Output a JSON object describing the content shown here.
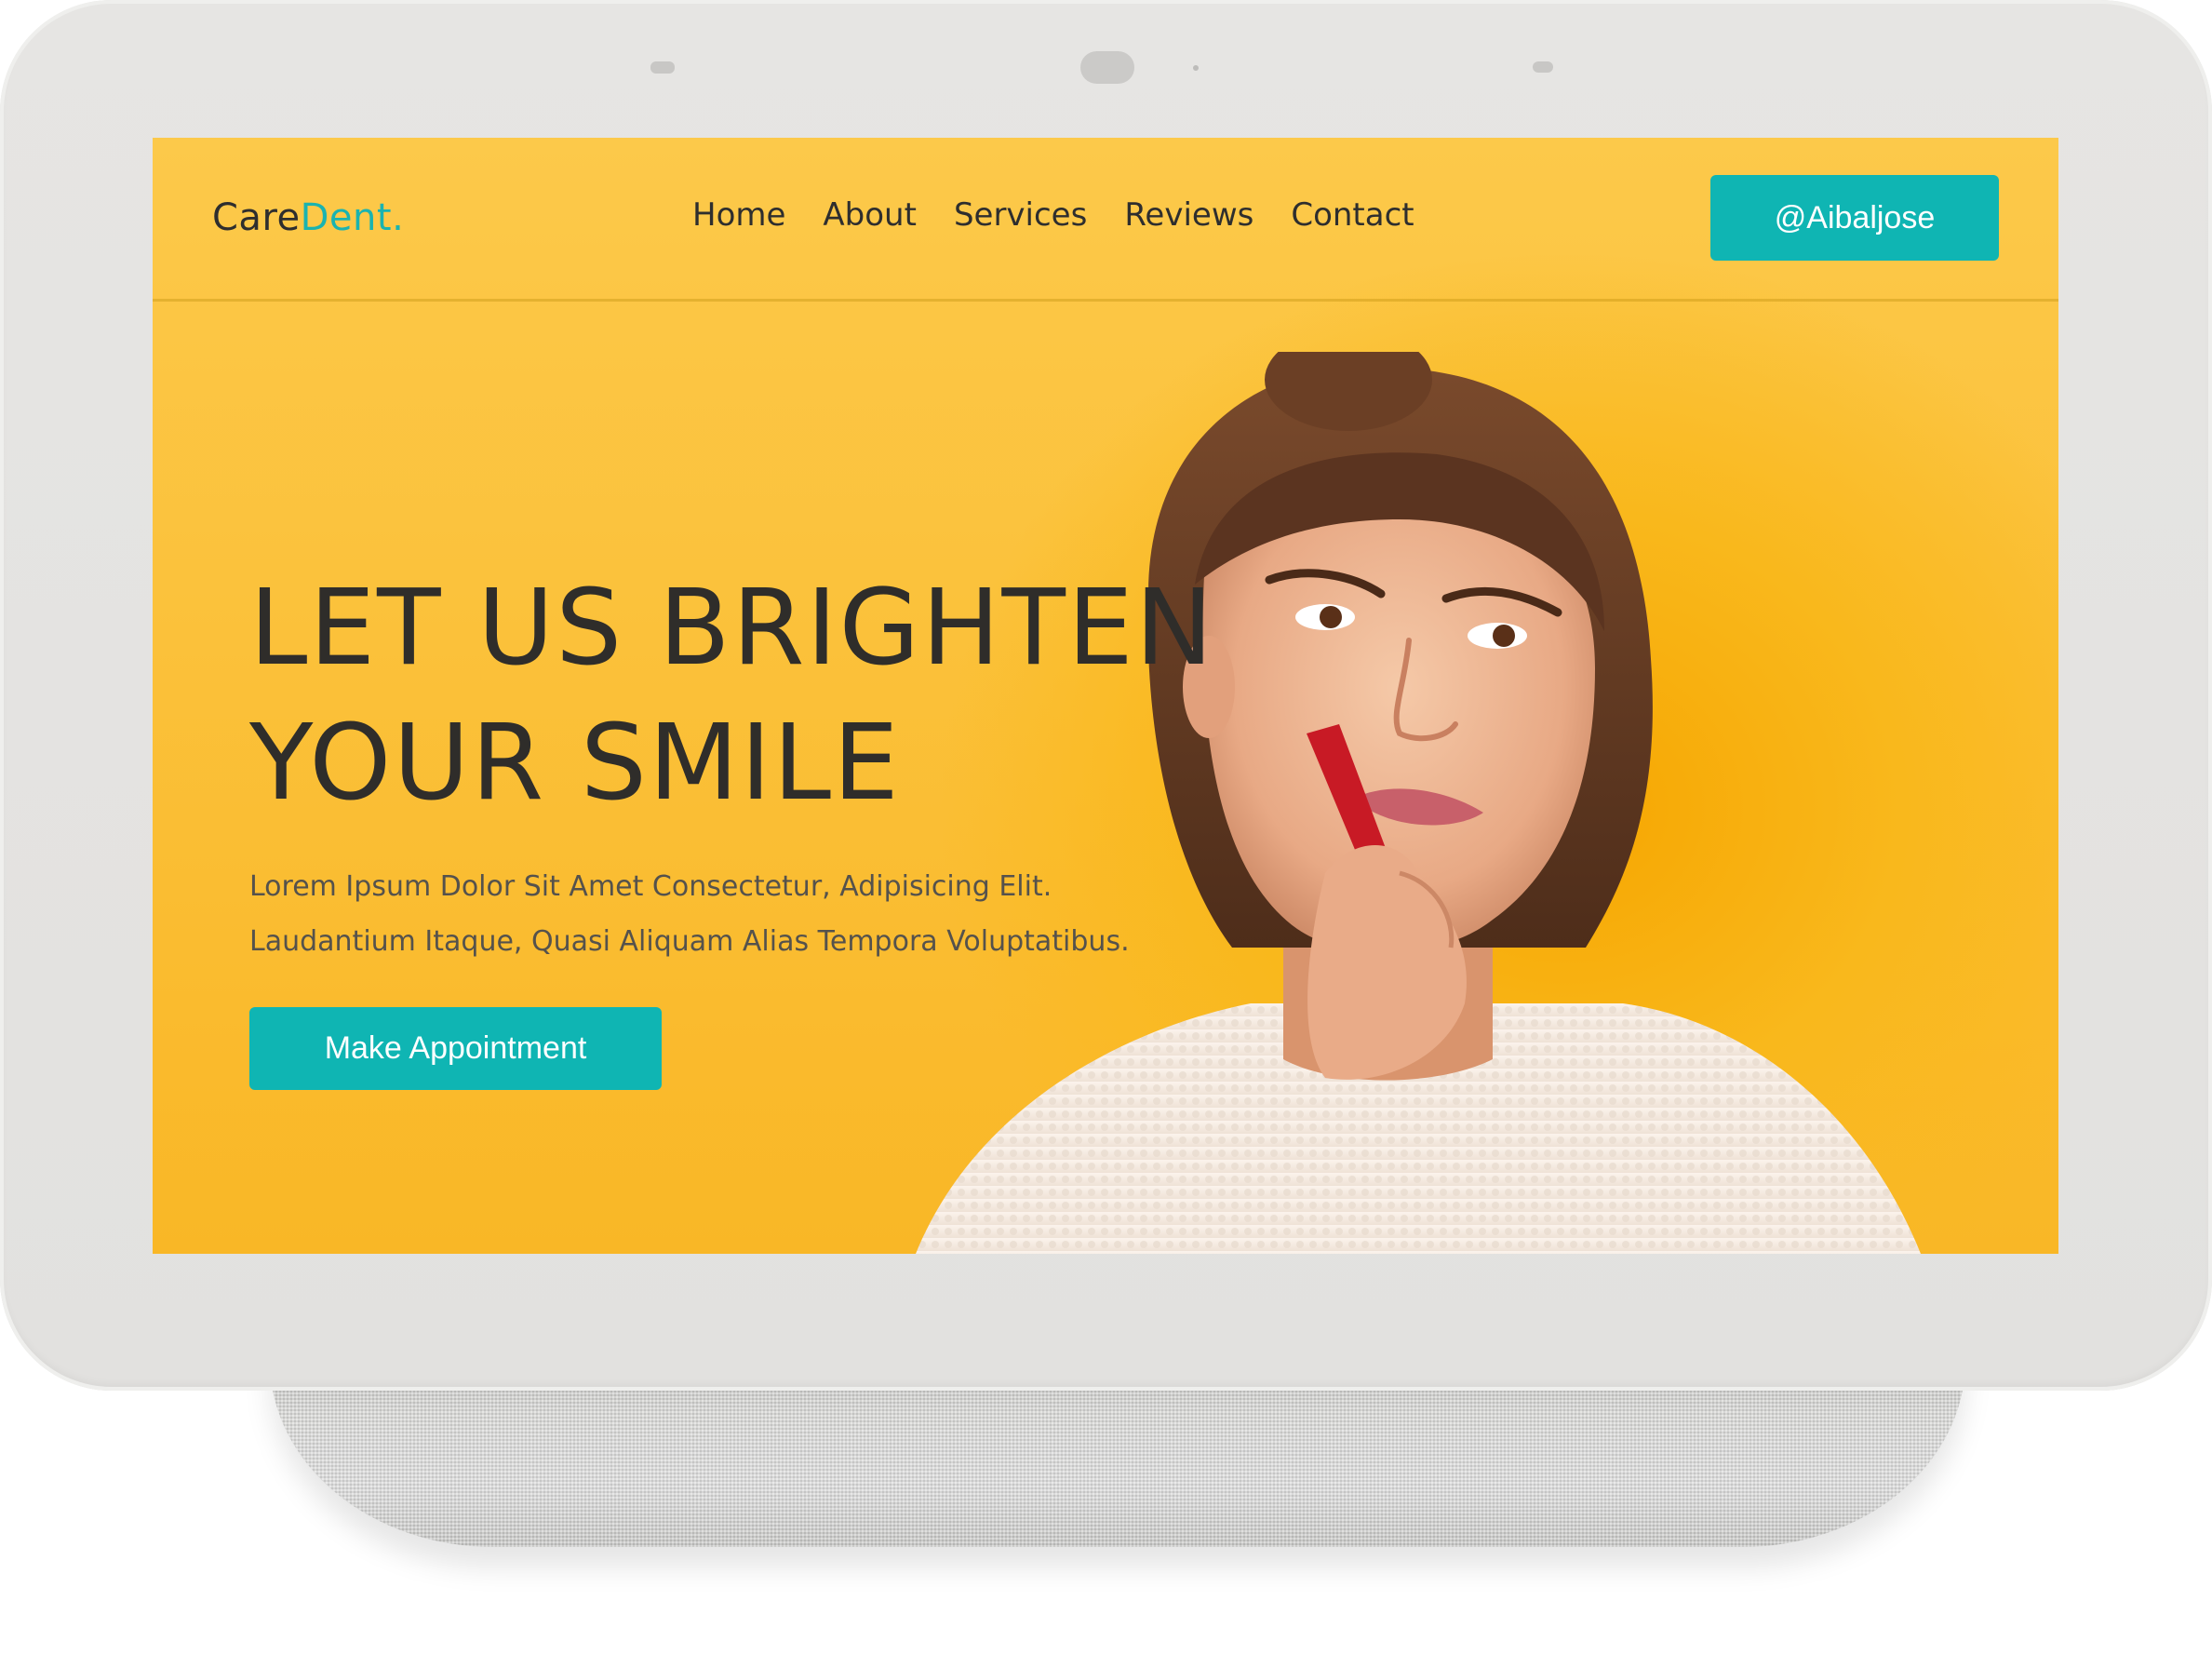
{
  "brand": {
    "name_part1": "Care",
    "name_part2": "Dent.",
    "accent_color": "#1ab3b0"
  },
  "nav": {
    "items": [
      {
        "label": "Home"
      },
      {
        "label": "About"
      },
      {
        "label": "Services"
      },
      {
        "label": "Reviews"
      },
      {
        "label": "Contact"
      }
    ],
    "handle_button": "@Aibaljose"
  },
  "hero": {
    "title_line1": "LET US BRIGHTEN",
    "title_line2": "YOUR SMILE",
    "text_line1": "Lorem Ipsum Dolor Sit Amet Consectetur, Adipisicing Elit.",
    "text_line2": "Laudantium Itaque, Quasi Aliquam Alias Tempora Voluptatibus.",
    "cta_label": "Make Appointment"
  },
  "colors": {
    "background_yellow": "#fbc13a",
    "button_teal": "#0fb5b3",
    "text_dark": "#2f2d2a",
    "device_frame": "#e3e2e0"
  },
  "icons": {
    "hero_image": "girl-with-toothbrush-photo"
  }
}
